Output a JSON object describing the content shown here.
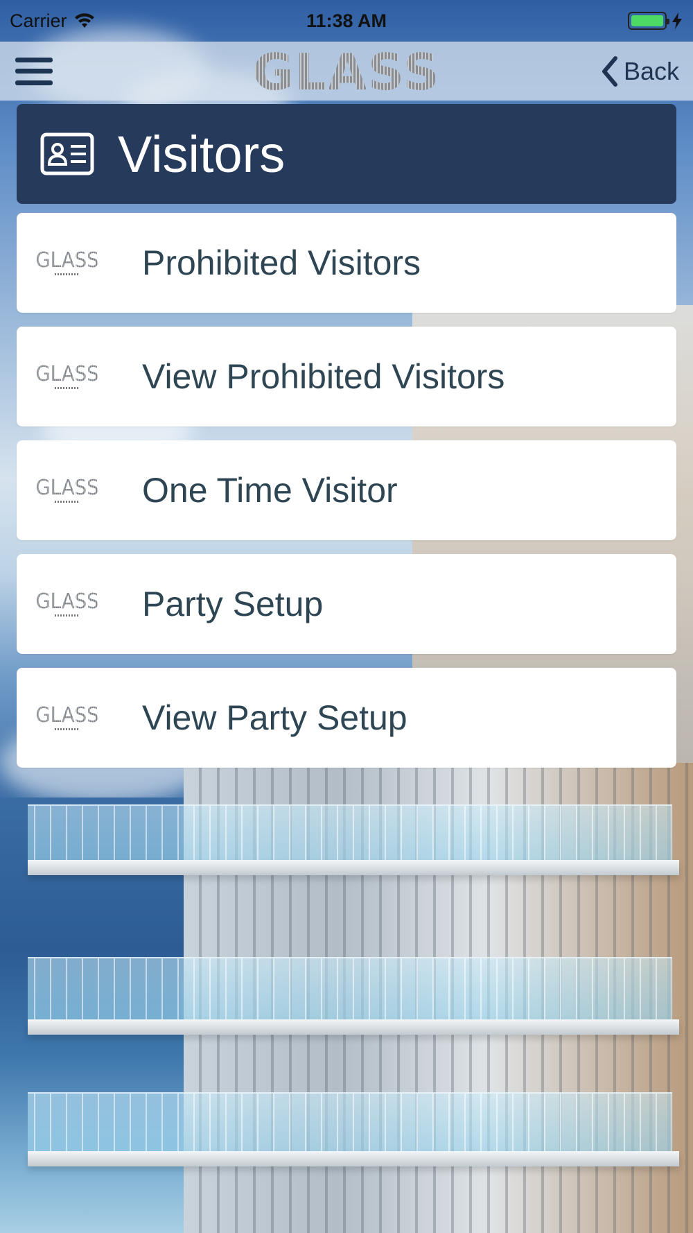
{
  "status_bar": {
    "carrier": "Carrier",
    "time": "11:38 AM",
    "wifi_icon": "wifi-icon",
    "battery_icon": "battery-icon",
    "charging_icon": "bolt-icon",
    "battery_color": "#4cd964"
  },
  "nav": {
    "menu_icon": "hamburger-menu-icon",
    "logo_text": "GLASS",
    "back_label": "Back",
    "back_icon": "chevron-left-icon"
  },
  "header": {
    "icon": "id-card-icon",
    "title": "Visitors",
    "color": "#263a5b"
  },
  "menu": {
    "logo_text": "GLASS",
    "items": [
      {
        "label": "Prohibited Visitors"
      },
      {
        "label": "View Prohibited Visitors"
      },
      {
        "label": "One Time Visitor"
      },
      {
        "label": "Party Setup"
      },
      {
        "label": "View Party Setup"
      }
    ]
  },
  "colors": {
    "navy": "#263a5b",
    "nav_icon": "#1e3453",
    "item_text": "#2e4553"
  }
}
